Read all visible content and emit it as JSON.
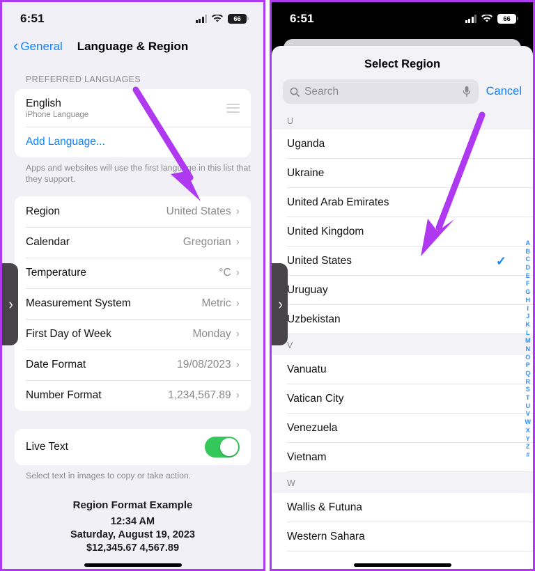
{
  "accent": {
    "purple_annotation": "#ae39f0",
    "ios_blue": "#0b84ff",
    "toggle_green": "#34c759",
    "gray_text": "#8a8a8e"
  },
  "left": {
    "status": {
      "time": "6:51",
      "battery": "66",
      "signal_icon": "cellular-bars-icon",
      "wifi_icon": "wifi-icon",
      "battery_icon": "battery-icon"
    },
    "nav": {
      "back_label": "General",
      "back_icon": "chevron-left-icon",
      "title": "Language & Region"
    },
    "languages": {
      "section_header": "PREFERRED LANGUAGES",
      "items": [
        {
          "name": "English",
          "subtitle": "iPhone Language",
          "handle_icon": "reorder-handle-icon"
        }
      ],
      "add_label": "Add Language...",
      "footnote": "Apps and websites will use the first language in this list that they support."
    },
    "settings_rows": [
      {
        "label": "Region",
        "value": "United States"
      },
      {
        "label": "Calendar",
        "value": "Gregorian"
      },
      {
        "label": "Temperature",
        "value": "°C"
      },
      {
        "label": "Measurement System",
        "value": "Metric"
      },
      {
        "label": "First Day of Week",
        "value": "Monday"
      },
      {
        "label": "Date Format",
        "value": "19/08/2023"
      },
      {
        "label": "Number Format",
        "value": "1,234,567.89"
      }
    ],
    "live_text": {
      "label": "Live Text",
      "enabled": true,
      "footnote": "Select text in images to copy or take action."
    },
    "example": {
      "title": "Region Format Example",
      "time": "12:34 AM",
      "date": "Saturday, August 19, 2023",
      "numbers": "$12,345.67   4,567.89"
    },
    "edge_tab_icon": "chevron-right-icon"
  },
  "right": {
    "status": {
      "time": "6:51",
      "battery": "66",
      "signal_icon": "cellular-bars-icon",
      "wifi_icon": "wifi-icon",
      "battery_icon": "battery-icon"
    },
    "sheet_title": "Select Region",
    "search": {
      "placeholder": "Search",
      "search_icon": "search-icon",
      "mic_icon": "microphone-icon"
    },
    "cancel_label": "Cancel",
    "groups": [
      {
        "letter": "U",
        "items": [
          {
            "name": "Uganda",
            "selected": false
          },
          {
            "name": "Ukraine",
            "selected": false
          },
          {
            "name": "United Arab Emirates",
            "selected": false
          },
          {
            "name": "United Kingdom",
            "selected": false
          },
          {
            "name": "United States",
            "selected": true
          },
          {
            "name": "Uruguay",
            "selected": false
          },
          {
            "name": "Uzbekistan",
            "selected": false
          }
        ]
      },
      {
        "letter": "V",
        "items": [
          {
            "name": "Vanuatu",
            "selected": false
          },
          {
            "name": "Vatican City",
            "selected": false
          },
          {
            "name": "Venezuela",
            "selected": false
          },
          {
            "name": "Vietnam",
            "selected": false
          }
        ]
      },
      {
        "letter": "W",
        "items": [
          {
            "name": "Wallis & Futuna",
            "selected": false
          },
          {
            "name": "Western Sahara",
            "selected": false
          }
        ]
      }
    ],
    "alpha_index": [
      "A",
      "B",
      "C",
      "D",
      "E",
      "F",
      "G",
      "H",
      "I",
      "J",
      "K",
      "L",
      "M",
      "N",
      "O",
      "P",
      "Q",
      "R",
      "S",
      "T",
      "U",
      "V",
      "W",
      "X",
      "Y",
      "Z",
      "#"
    ],
    "check_icon": "checkmark-icon",
    "edge_tab_icon": "chevron-right-icon"
  }
}
